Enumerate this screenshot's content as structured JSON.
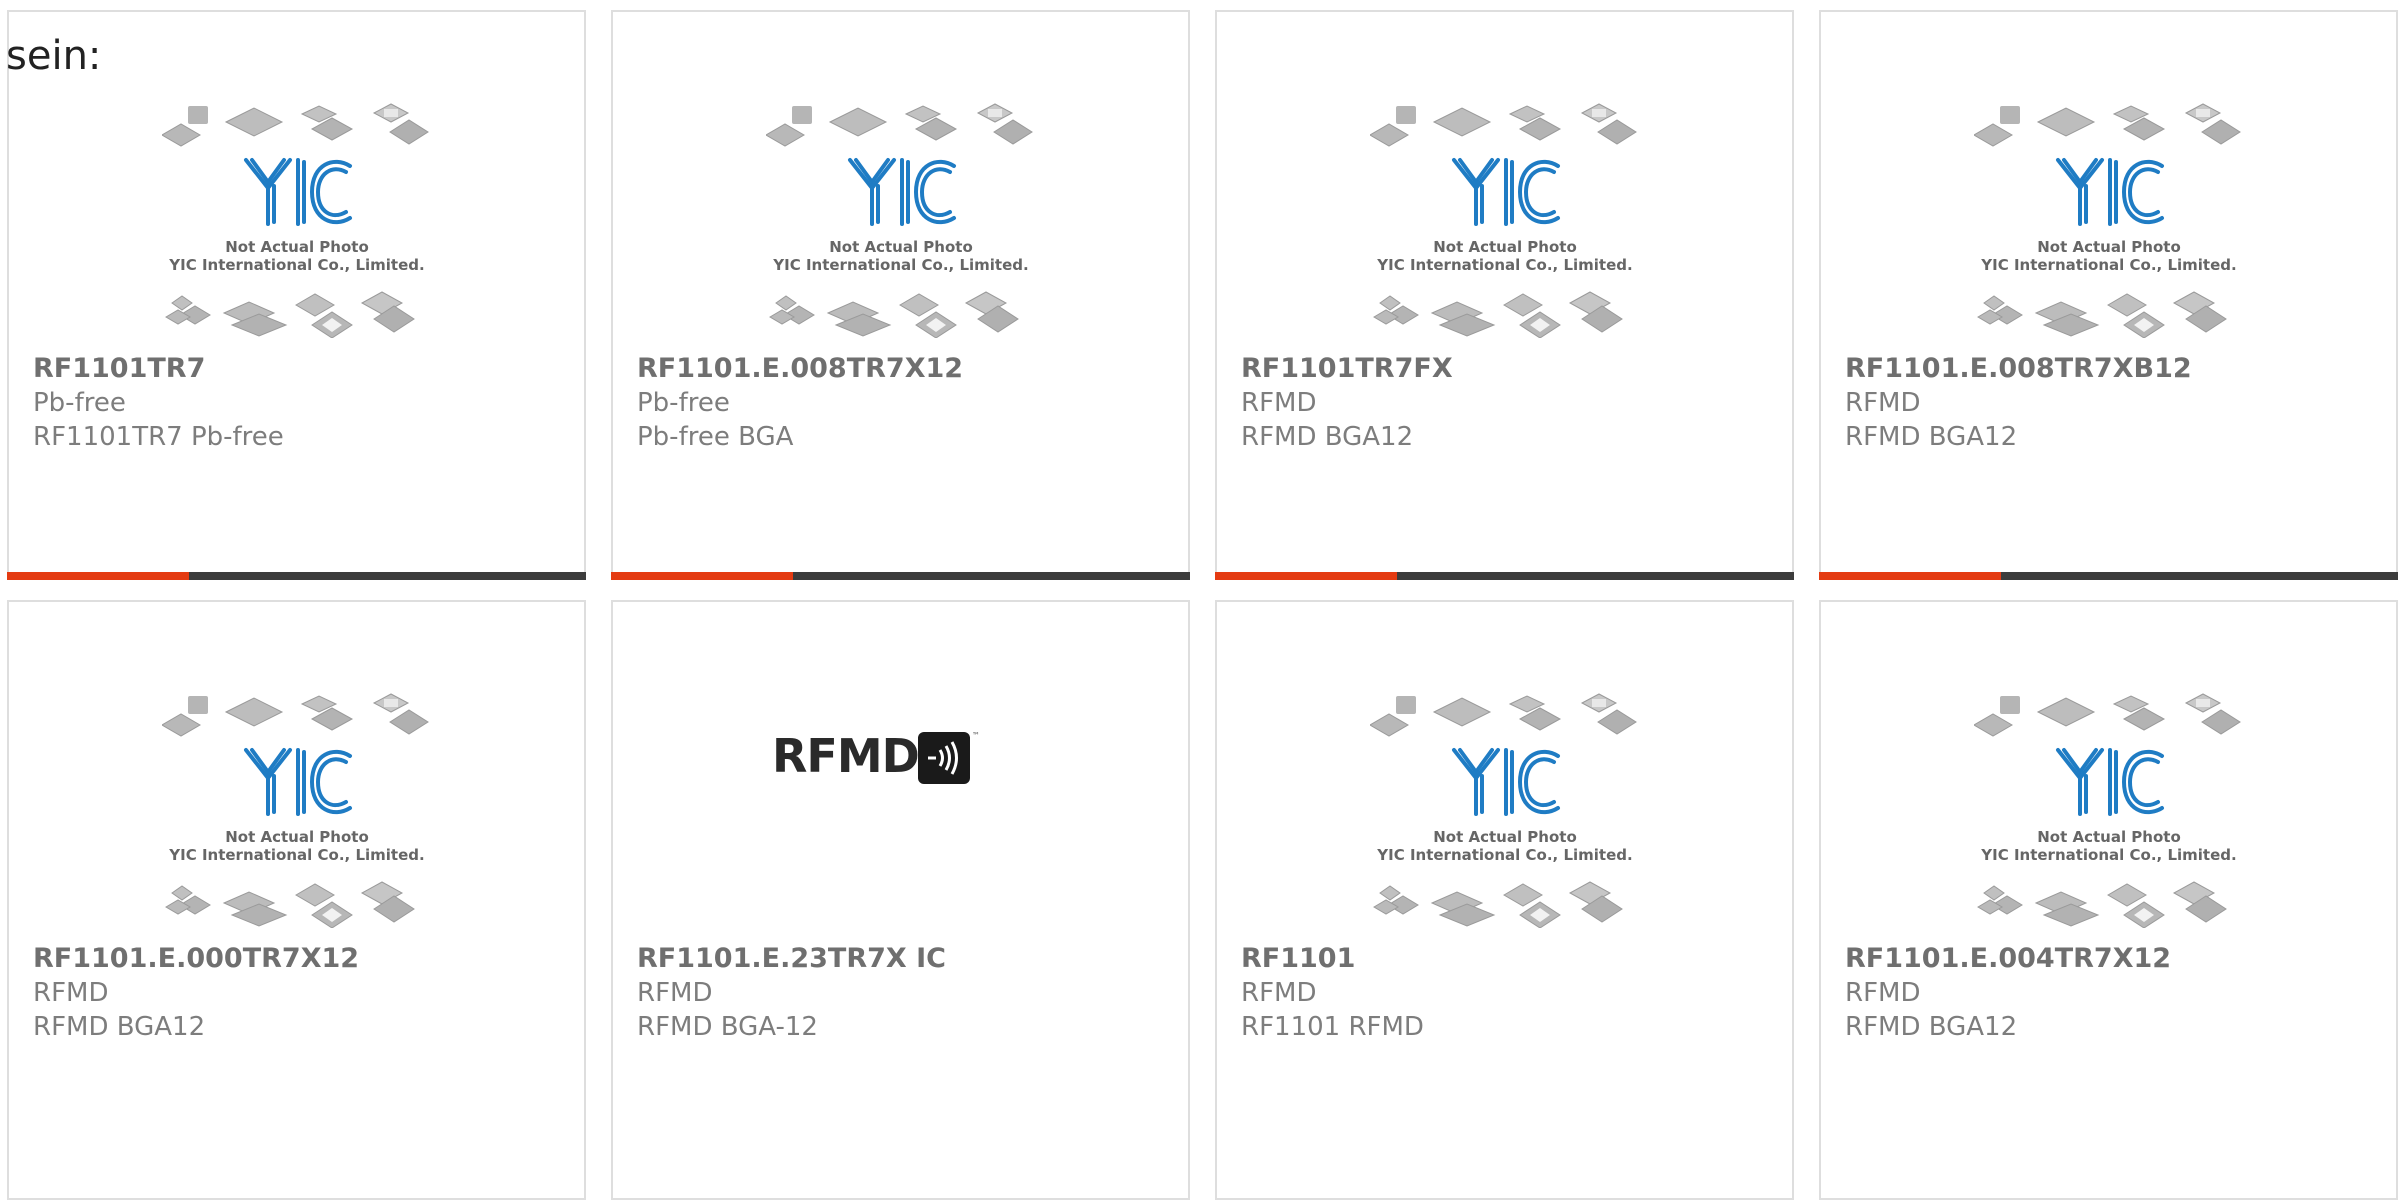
{
  "lead_text": "sein:",
  "accent_colors": {
    "accent": "#e43b12",
    "bar": "#3c3c3c",
    "border": "#dedede",
    "logo_blue": "#1f7cc4"
  },
  "placeholder": {
    "line1": "Not Actual Photo",
    "line2": "YIC International Co., Limited.",
    "logo_text": "YIC"
  },
  "rfmd_logo_text": "RFMD",
  "products": [
    {
      "part": "RF1101TR7",
      "brand": "Pb-free",
      "desc": "RF1101TR7 Pb-free",
      "image": "yic-placeholder",
      "accent_bar": true
    },
    {
      "part": "RF1101.E.008TR7X12",
      "brand": "Pb-free",
      "desc": "Pb-free BGA",
      "image": "yic-placeholder",
      "accent_bar": true
    },
    {
      "part": "RF1101TR7FX",
      "brand": "RFMD",
      "desc": "RFMD BGA12",
      "image": "yic-placeholder",
      "accent_bar": true
    },
    {
      "part": "RF1101.E.008TR7XB12",
      "brand": "RFMD",
      "desc": "RFMD BGA12",
      "image": "yic-placeholder",
      "accent_bar": true
    },
    {
      "part": "RF1101.E.000TR7X12",
      "brand": "RFMD",
      "desc": "RFMD BGA12",
      "image": "yic-placeholder",
      "accent_bar": false
    },
    {
      "part": "RF1101.E.23TR7X IC",
      "brand": "RFMD",
      "desc": "RFMD BGA-12",
      "image": "rfmd-logo",
      "accent_bar": false
    },
    {
      "part": "RF1101",
      "brand": "RFMD",
      "desc": "RF1101 RFMD",
      "image": "yic-placeholder",
      "accent_bar": false
    },
    {
      "part": "RF1101.E.004TR7X12",
      "brand": "RFMD",
      "desc": "RFMD BGA12",
      "image": "yic-placeholder",
      "accent_bar": false
    }
  ]
}
